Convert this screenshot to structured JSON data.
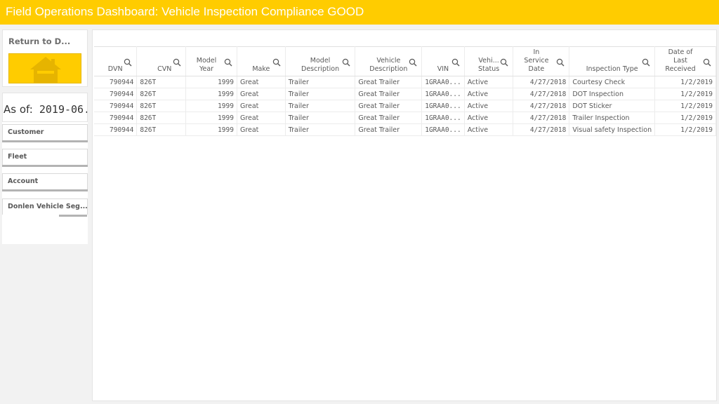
{
  "header": {
    "title": "Field Operations Dashboard: Vehicle Inspection Compliance GOOD"
  },
  "sidebar": {
    "return_label": "Return to D...",
    "home_icon": "home-icon",
    "as_of_label": "As of:",
    "as_of_value": "2019-06...",
    "filters": [
      {
        "label": "Customer"
      },
      {
        "label": "Fleet"
      },
      {
        "label": "Account"
      },
      {
        "label": "Donlen Vehicle Seg..."
      }
    ]
  },
  "table": {
    "columns": [
      {
        "l1": "",
        "l2": "",
        "l3": "DVN"
      },
      {
        "l1": "",
        "l2": "",
        "l3": "CVN"
      },
      {
        "l1": "",
        "l2": "Model",
        "l3": "Year"
      },
      {
        "l1": "",
        "l2": "",
        "l3": "Make"
      },
      {
        "l1": "",
        "l2": "Model",
        "l3": "Description"
      },
      {
        "l1": "",
        "l2": "Vehicle",
        "l3": "Description"
      },
      {
        "l1": "",
        "l2": "",
        "l3": "VIN"
      },
      {
        "l1": "",
        "l2": "Vehi...",
        "l3": "Status"
      },
      {
        "l1": "In",
        "l2": "Service",
        "l3": "Date"
      },
      {
        "l1": "",
        "l2": "",
        "l3": "Inspection Type"
      },
      {
        "l1": "Date of",
        "l2": "Last",
        "l3": "Received"
      }
    ],
    "rows": [
      [
        "790944",
        "826T",
        "1999",
        "Great",
        "Trailer",
        "Great Trailer",
        "1GRAA0...",
        "Active",
        "4/27/2018",
        "Courtesy Check",
        "1/2/2019"
      ],
      [
        "790944",
        "826T",
        "1999",
        "Great",
        "Trailer",
        "Great Trailer",
        "1GRAA0...",
        "Active",
        "4/27/2018",
        "DOT Inspection",
        "1/2/2019"
      ],
      [
        "790944",
        "826T",
        "1999",
        "Great",
        "Trailer",
        "Great Trailer",
        "1GRAA0...",
        "Active",
        "4/27/2018",
        "DOT Sticker",
        "1/2/2019"
      ],
      [
        "790944",
        "826T",
        "1999",
        "Great",
        "Trailer",
        "Great Trailer",
        "1GRAA0...",
        "Active",
        "4/27/2018",
        "Trailer Inspection",
        "1/2/2019"
      ],
      [
        "790944",
        "826T",
        "1999",
        "Great",
        "Trailer",
        "Great Trailer",
        "1GRAA0...",
        "Active",
        "4/27/2018",
        "Visual safety Inspection",
        "1/2/2019"
      ]
    ]
  },
  "colors": {
    "accent": "#ffcc00",
    "home_icon": "#e6b400"
  }
}
